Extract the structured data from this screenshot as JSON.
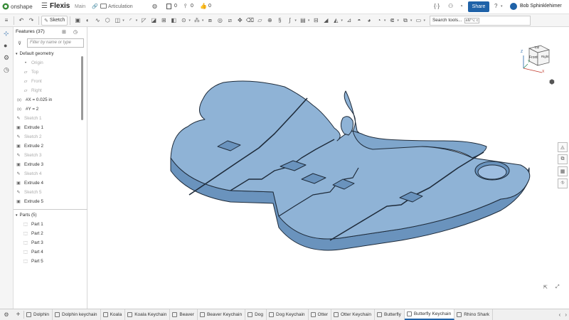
{
  "app": {
    "logo": "onshape",
    "doc_title": "Flexis",
    "branch": "Main",
    "workspace": "Articulation",
    "count_versions": "0",
    "count_branches": "0",
    "count_likes": "0",
    "share_label": "Share",
    "user": "Bob Sphinklehimer"
  },
  "toolbar": {
    "sketch_label": "Sketch",
    "search_label": "Search tools...",
    "search_hint": "alt/⌥ c"
  },
  "features": {
    "title": "Features (37)",
    "filter_placeholder": "Filter by name or type",
    "default_geometry": "Default geometry",
    "items": [
      {
        "label": "Origin",
        "dim": true,
        "icon": "point-icon"
      },
      {
        "label": "Top",
        "dim": true,
        "icon": "plane-icon"
      },
      {
        "label": "Front",
        "dim": true,
        "icon": "plane-icon"
      },
      {
        "label": "Right",
        "dim": true,
        "icon": "plane-icon"
      },
      {
        "label": "#X = 0.025 in",
        "dim": false,
        "icon": "variable-icon"
      },
      {
        "label": "#Y = 2",
        "dim": false,
        "icon": "variable-icon"
      },
      {
        "label": "Sketch 1",
        "dim": true,
        "icon": "sketch-icon"
      },
      {
        "label": "Extrude 1",
        "dim": false,
        "icon": "extrude-icon"
      },
      {
        "label": "Sketch 2",
        "dim": true,
        "icon": "sketch-icon"
      },
      {
        "label": "Extrude 2",
        "dim": false,
        "icon": "extrude-icon"
      },
      {
        "label": "Sketch 3",
        "dim": true,
        "icon": "sketch-icon"
      },
      {
        "label": "Extrude 3",
        "dim": false,
        "icon": "extrude-icon"
      },
      {
        "label": "Sketch 4",
        "dim": true,
        "icon": "sketch-icon"
      },
      {
        "label": "Extrude 4",
        "dim": false,
        "icon": "extrude-icon"
      },
      {
        "label": "Sketch 5",
        "dim": true,
        "icon": "sketch-icon"
      },
      {
        "label": "Extrude 5",
        "dim": false,
        "icon": "extrude-icon"
      }
    ],
    "parts_title": "Parts (5)",
    "parts": [
      "Part 1",
      "Part 2",
      "Part 3",
      "Part 4",
      "Part 5"
    ]
  },
  "viewcube": {
    "top": "Top",
    "front": "Front",
    "right": "Right",
    "axis_x": "X",
    "axis_y": "Y",
    "axis_z": "Z"
  },
  "tabs": [
    {
      "label": "Dolphin",
      "active": false
    },
    {
      "label": "Dolphin keychain",
      "active": false
    },
    {
      "label": "Koala",
      "active": false
    },
    {
      "label": "Koala Keychain",
      "active": false
    },
    {
      "label": "Beaver",
      "active": false
    },
    {
      "label": "Beaver Keychain",
      "active": false
    },
    {
      "label": "Dog",
      "active": false
    },
    {
      "label": "Dog Keychain",
      "active": false
    },
    {
      "label": "Otter",
      "active": false
    },
    {
      "label": "Otter Keychain",
      "active": false
    },
    {
      "label": "Butterfly",
      "active": false
    },
    {
      "label": "Butterfly Keychain",
      "active": true
    },
    {
      "label": "Rhino Shark",
      "active": false
    }
  ],
  "colors": {
    "accent": "#1f62a8",
    "model_top": "#8fb3d6",
    "model_side": "#6a93bd",
    "model_edge": "#1e2b3a"
  }
}
